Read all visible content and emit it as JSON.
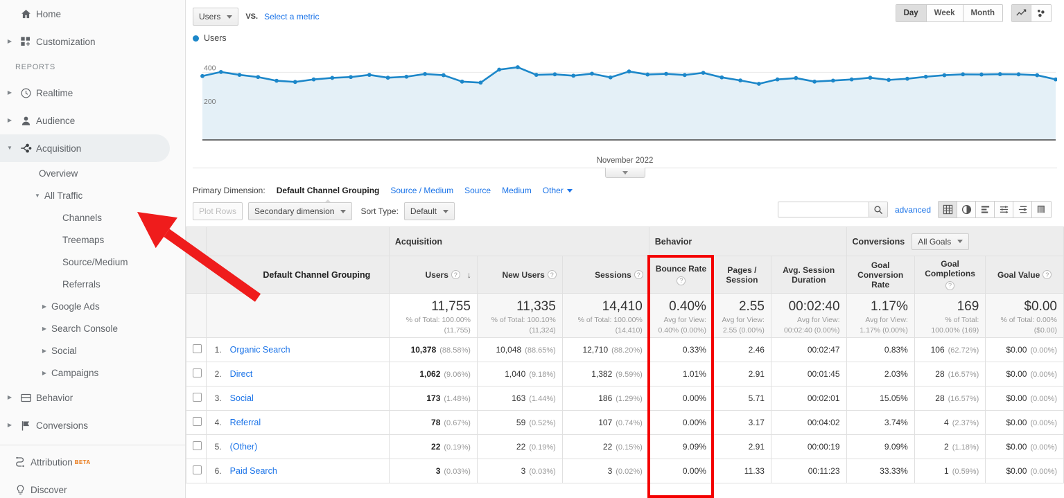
{
  "sidebar": {
    "home": {
      "label": "Home",
      "icon": "home-icon"
    },
    "customization": {
      "label": "Customization",
      "icon": "customization-icon"
    },
    "reports_label": "REPORTS",
    "reports": [
      {
        "label": "Realtime",
        "icon": "clock-icon"
      },
      {
        "label": "Audience",
        "icon": "person-icon"
      },
      {
        "label": "Acquisition",
        "icon": "acquisition-icon"
      }
    ],
    "acquisition_children": [
      {
        "label": "Overview",
        "level": 1
      },
      {
        "label": "All Traffic",
        "level": 1,
        "twisty": "down"
      },
      {
        "label": "Channels",
        "level": 2,
        "selected": true
      },
      {
        "label": "Treemaps",
        "level": 2
      },
      {
        "label": "Source/Medium",
        "level": 2
      },
      {
        "label": "Referrals",
        "level": 2
      },
      {
        "label": "Google Ads",
        "level": 1,
        "twisty": "right"
      },
      {
        "label": "Search Console",
        "level": 1,
        "twisty": "right"
      },
      {
        "label": "Social",
        "level": 1,
        "twisty": "right"
      },
      {
        "label": "Campaigns",
        "level": 1,
        "twisty": "right"
      }
    ],
    "after": [
      {
        "label": "Behavior",
        "icon": "behavior-icon"
      },
      {
        "label": "Conversions",
        "icon": "flag-icon"
      }
    ],
    "bottom": [
      {
        "label": "Attribution",
        "icon": "attribution-icon",
        "badge": "BETA"
      },
      {
        "label": "Discover",
        "icon": "bulb-icon"
      }
    ]
  },
  "toolbar": {
    "metric_selected": "Users",
    "vs_label": "VS.",
    "select_metric": "Select a metric",
    "ranges": [
      "Day",
      "Week",
      "Month"
    ],
    "range_active": "Day",
    "view_icons": [
      "line-chart-icon",
      "motion-chart-icon"
    ],
    "view_active": "line-chart-icon"
  },
  "chart_data": {
    "type": "area",
    "title": "Users",
    "legend": [
      "Users"
    ],
    "legend_position": "top-left",
    "xlabel": "November 2022",
    "ylabel": "",
    "ylim": [
      0,
      500
    ],
    "yticks": [
      200,
      400
    ],
    "grid": true,
    "series_color": "#1c87c9",
    "fill_color": "#e4f0f7",
    "x": [
      "Nov 1",
      "Nov 2",
      "Nov 3",
      "Nov 4",
      "Nov 5",
      "Nov 6",
      "Nov 7",
      "Nov 8",
      "Nov 9",
      "Nov 10",
      "Nov 11",
      "Nov 12",
      "Nov 13",
      "Nov 14",
      "Nov 15",
      "Nov 16",
      "Nov 17",
      "Nov 18",
      "Nov 19",
      "Nov 20",
      "Nov 21",
      "Nov 22",
      "Nov 23",
      "Nov 24",
      "Nov 25",
      "Nov 26",
      "Nov 27",
      "Nov 28",
      "Nov 29",
      "Nov 30",
      "Dec 1",
      "Dec 2",
      "Dec 3",
      "Dec 4",
      "Dec 5",
      "Dec 6",
      "Dec 7",
      "Dec 8",
      "Dec 9",
      "Dec 10",
      "Dec 11",
      "Dec 12",
      "Dec 13",
      "Dec 14",
      "Dec 15",
      "Dec 16",
      "Dec 17"
    ],
    "values": [
      378,
      402,
      385,
      372,
      350,
      343,
      358,
      367,
      372,
      385,
      368,
      374,
      390,
      383,
      345,
      339,
      416,
      430,
      385,
      388,
      380,
      392,
      370,
      405,
      387,
      391,
      384,
      397,
      370,
      352,
      332,
      358,
      366,
      345,
      351,
      358,
      368,
      355,
      362,
      374,
      383,
      388,
      387,
      389,
      388,
      383,
      358
    ]
  },
  "dimension_row": {
    "label": "Primary Dimension:",
    "current": "Default Channel Grouping",
    "links": [
      "Source / Medium",
      "Source",
      "Medium"
    ],
    "other": "Other"
  },
  "controls": {
    "plot_rows": "Plot Rows",
    "secondary_dimension": "Secondary dimension",
    "sort_type_label": "Sort Type:",
    "sort_type_value": "Default",
    "search_value": "",
    "search_placeholder": "",
    "advanced": "advanced",
    "view_icons": [
      "table-view-icon",
      "pie-view-icon",
      "bar-view-icon",
      "comparison-view-icon",
      "pivot-view-icon",
      "performance-view-icon"
    ],
    "view_active": "table-view-icon"
  },
  "table": {
    "groups": [
      {
        "label": "Acquisition",
        "span": 3
      },
      {
        "label": "Behavior",
        "span": 3
      },
      {
        "label": "Conversions",
        "span": 3,
        "select": "All Goals"
      }
    ],
    "dimension_header": "Default Channel Grouping",
    "columns": [
      {
        "label": "Users",
        "help": true,
        "sorted": "desc"
      },
      {
        "label": "New Users",
        "help": true
      },
      {
        "label": "Sessions",
        "help": true
      },
      {
        "label": "Bounce Rate",
        "help": true,
        "highlighted": true
      },
      {
        "label": "Pages / Session",
        "help": true
      },
      {
        "label": "Avg. Session Duration",
        "help": true
      },
      {
        "label": "Goal Conversion Rate",
        "help": true
      },
      {
        "label": "Goal Completions",
        "help": true
      },
      {
        "label": "Goal Value",
        "help": true
      }
    ],
    "summary": [
      {
        "value": "11,755",
        "sub1": "% of Total: 100.00%",
        "sub2": "(11,755)"
      },
      {
        "value": "11,335",
        "sub1": "% of Total: 100.10%",
        "sub2": "(11,324)"
      },
      {
        "value": "14,410",
        "sub1": "% of Total: 100.00%",
        "sub2": "(14,410)"
      },
      {
        "value": "0.40%",
        "sub1": "Avg for View:",
        "sub2": "0.40% (0.00%)"
      },
      {
        "value": "2.55",
        "sub1": "Avg for View:",
        "sub2": "2.55 (0.00%)"
      },
      {
        "value": "00:02:40",
        "sub1": "Avg for View:",
        "sub2": "00:02:40 (0.00%)"
      },
      {
        "value": "1.17%",
        "sub1": "Avg for View:",
        "sub2": "1.17% (0.00%)"
      },
      {
        "value": "169",
        "sub1": "% of Total:",
        "sub2": "100.00% (169)"
      },
      {
        "value": "$0.00",
        "sub1": "% of Total: 0.00%",
        "sub2": "($0.00)"
      }
    ],
    "rows": [
      {
        "rank": "1.",
        "name": "Organic Search",
        "users": "10,378",
        "users_pct": "(88.58%)",
        "new_users": "10,048",
        "new_users_pct": "(88.65%)",
        "sessions": "12,710",
        "sessions_pct": "(88.20%)",
        "bounce": "0.33%",
        "pages": "2.46",
        "duration": "00:02:47",
        "goal_rate": "0.83%",
        "goal_completions": "106",
        "goal_completions_pct": "(62.72%)",
        "goal_value": "$0.00",
        "goal_value_pct": "(0.00%)"
      },
      {
        "rank": "2.",
        "name": "Direct",
        "users": "1,062",
        "users_pct": "(9.06%)",
        "new_users": "1,040",
        "new_users_pct": "(9.18%)",
        "sessions": "1,382",
        "sessions_pct": "(9.59%)",
        "bounce": "1.01%",
        "pages": "2.91",
        "duration": "00:01:45",
        "goal_rate": "2.03%",
        "goal_completions": "28",
        "goal_completions_pct": "(16.57%)",
        "goal_value": "$0.00",
        "goal_value_pct": "(0.00%)"
      },
      {
        "rank": "3.",
        "name": "Social",
        "users": "173",
        "users_pct": "(1.48%)",
        "new_users": "163",
        "new_users_pct": "(1.44%)",
        "sessions": "186",
        "sessions_pct": "(1.29%)",
        "bounce": "0.00%",
        "pages": "5.71",
        "duration": "00:02:01",
        "goal_rate": "15.05%",
        "goal_completions": "28",
        "goal_completions_pct": "(16.57%)",
        "goal_value": "$0.00",
        "goal_value_pct": "(0.00%)"
      },
      {
        "rank": "4.",
        "name": "Referral",
        "users": "78",
        "users_pct": "(0.67%)",
        "new_users": "59",
        "new_users_pct": "(0.52%)",
        "sessions": "107",
        "sessions_pct": "(0.74%)",
        "bounce": "0.00%",
        "pages": "3.17",
        "duration": "00:04:02",
        "goal_rate": "3.74%",
        "goal_completions": "4",
        "goal_completions_pct": "(2.37%)",
        "goal_value": "$0.00",
        "goal_value_pct": "(0.00%)"
      },
      {
        "rank": "5.",
        "name": "(Other)",
        "users": "22",
        "users_pct": "(0.19%)",
        "new_users": "22",
        "new_users_pct": "(0.19%)",
        "sessions": "22",
        "sessions_pct": "(0.15%)",
        "bounce": "9.09%",
        "pages": "2.91",
        "duration": "00:00:19",
        "goal_rate": "9.09%",
        "goal_completions": "2",
        "goal_completions_pct": "(1.18%)",
        "goal_value": "$0.00",
        "goal_value_pct": "(0.00%)"
      },
      {
        "rank": "6.",
        "name": "Paid Search",
        "users": "3",
        "users_pct": "(0.03%)",
        "new_users": "3",
        "new_users_pct": "(0.03%)",
        "sessions": "3",
        "sessions_pct": "(0.02%)",
        "bounce": "0.00%",
        "pages": "11.33",
        "duration": "00:11:23",
        "goal_rate": "33.33%",
        "goal_completions": "1",
        "goal_completions_pct": "(0.59%)",
        "goal_value": "$0.00",
        "goal_value_pct": "(0.00%)"
      }
    ]
  },
  "annotations": {
    "highlight_color": "#f40000",
    "arrow_color": "#ef1c1c",
    "arrow_target": "sidebar-item-channels",
    "box_target": "column-bounce-rate"
  }
}
